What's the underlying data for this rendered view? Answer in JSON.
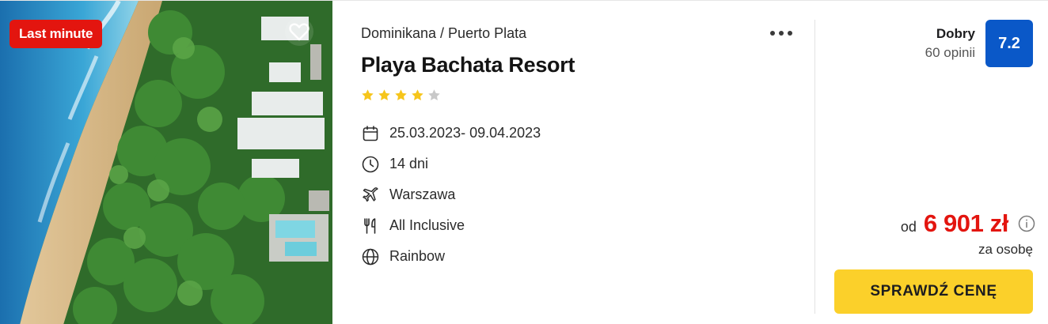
{
  "photo": {
    "badge": "Last minute",
    "favorite_icon": "heart-outline-icon"
  },
  "hotel": {
    "location": "Dominikana / Puerto Plata",
    "name": "Playa Bachata Resort",
    "stars_filled": 4,
    "stars_total": 5,
    "more_icon": "more-dots-icon"
  },
  "details": [
    {
      "icon": "calendar-icon",
      "text": "25.03.2023- 09.04.2023"
    },
    {
      "icon": "clock-icon",
      "text": "14 dni"
    },
    {
      "icon": "plane-icon",
      "text": "Warszawa"
    },
    {
      "icon": "cutlery-icon",
      "text": "All Inclusive"
    },
    {
      "icon": "globe-icon",
      "text": "Rainbow"
    }
  ],
  "rating": {
    "label": "Dobry",
    "count": "60 opinii",
    "score": "7.2"
  },
  "price": {
    "prefix": "od",
    "value": "6 901 zł",
    "per_person": "za osobę",
    "info_icon": "info-icon"
  },
  "cta": {
    "label": "SPRAWDŹ CENĘ"
  },
  "colors": {
    "accent_red": "#e3150f",
    "rating_blue": "#0a58c8",
    "cta_yellow": "#fbd02a",
    "star_yellow": "#f6c51b",
    "star_grey": "#c8c8c8"
  }
}
